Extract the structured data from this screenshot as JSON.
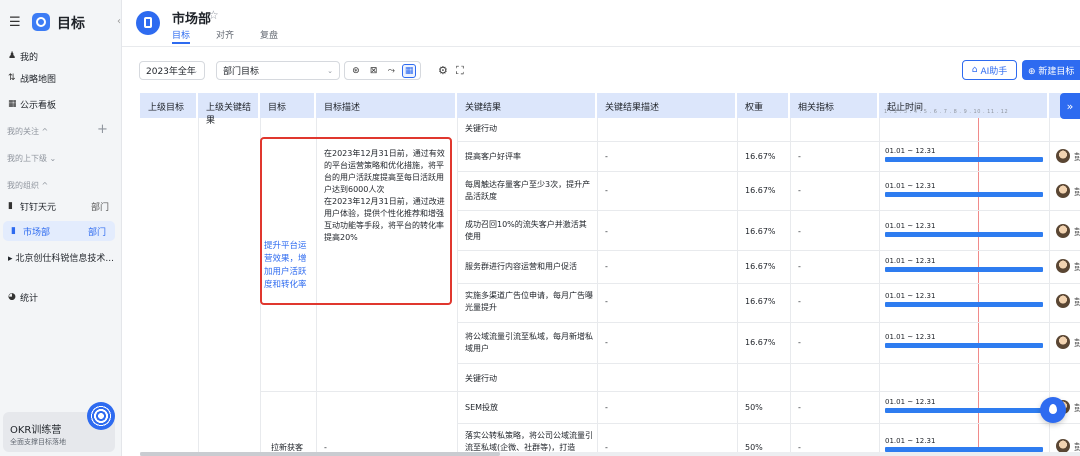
{
  "sidebar": {
    "title": "目标",
    "items": [
      {
        "icon": "person-icon",
        "label": "我的"
      },
      {
        "icon": "map-icon",
        "label": "战略地图"
      },
      {
        "icon": "board-icon",
        "label": "公示看板"
      }
    ],
    "groups": {
      "follow": "我的关注 ^",
      "reports": "我的上下级 ⌄",
      "org": "我的组织 ^"
    },
    "org_items": [
      {
        "label": "钉钉天元",
        "tag": "部门"
      },
      {
        "label": "市场部",
        "tag": "部门"
      },
      {
        "label": "▸ 北京创仕科锐信息技术..."
      }
    ],
    "stats": "统计",
    "okr": {
      "title": "OKR训练营",
      "subtitle": "全面支撑目标落地"
    }
  },
  "header": {
    "dept": "市场部",
    "tabs": [
      "目标",
      "对齐",
      "复盘"
    ]
  },
  "toolbar": {
    "period": "2023年全年",
    "scope": "部门目标",
    "ai_label": "AI助手",
    "new_label": "⊕ 新建目标"
  },
  "table": {
    "columns": [
      "上级目标",
      "上级关键结果",
      "目标",
      "目标描述",
      "关键结果",
      "关键结果描述",
      "权重",
      "相关指标",
      "起止时间"
    ],
    "months": "1 . 2 . 3 . 4 . 5 . 6 . 7 . 8 . 9 . 10 . 11 . 12",
    "objective": {
      "name": "提升平台运营效果，增加用户活跃度和转化率",
      "description": "在2023年12月31日前，通过有效的平台运营策略和优化措施，将平台的用户活跃度提高至每日活跃用户达到6000人次\n在2023年12月31日前，通过改进用户体验，提供个性化推荐和增强互动功能等手段，将平台的转化率提高20%"
    },
    "section_label": "关键行动",
    "rows": [
      {
        "kr": "提高客户好评率",
        "desc": "-",
        "weight": "16.67%",
        "metric": "-",
        "date": "01.01 ~ 12.31"
      },
      {
        "kr": "每周触达存量客户至少3次，提升产品活跃度",
        "desc": "-",
        "weight": "16.67%",
        "metric": "-",
        "date": "01.01 ~ 12.31"
      },
      {
        "kr": "成功召回10%的流失客户并激活其使用",
        "desc": "-",
        "weight": "16.67%",
        "metric": "-",
        "date": "01.01 ~ 12.31"
      },
      {
        "kr": "服务群进行内容运营和用户促活",
        "desc": "-",
        "weight": "16.67%",
        "metric": "-",
        "date": "01.01 ~ 12.31"
      },
      {
        "kr": "实施多渠道广告位申请，每月广告曝光量提升",
        "desc": "-",
        "weight": "16.67%",
        "metric": "-",
        "date": "01.01 ~ 12.31"
      },
      {
        "kr": "将公域流量引流至私域，每月新增私域用户",
        "desc": "-",
        "weight": "16.67%",
        "metric": "-",
        "date": "01.01 ~ 12.31"
      }
    ],
    "section2_label": "关键行动",
    "rows2": [
      {
        "kr": "SEM投放",
        "desc": "-",
        "weight": "50%",
        "metric": "-",
        "date": "01.01 ~ 12.31"
      },
      {
        "kr": "落实公转私策略，将公司公域流量引流至私域(企微、社群等)，打造",
        "desc": "-",
        "weight": "50%",
        "metric": "-",
        "date": "01.01 ~ 12.31"
      }
    ],
    "objective2": "拉新获客",
    "objective2_desc": "-",
    "owner_initial": "彭"
  },
  "colors": {
    "accent": "#2e6bf0",
    "highlight": "#e0372e",
    "bar": "#2e7cf0"
  }
}
